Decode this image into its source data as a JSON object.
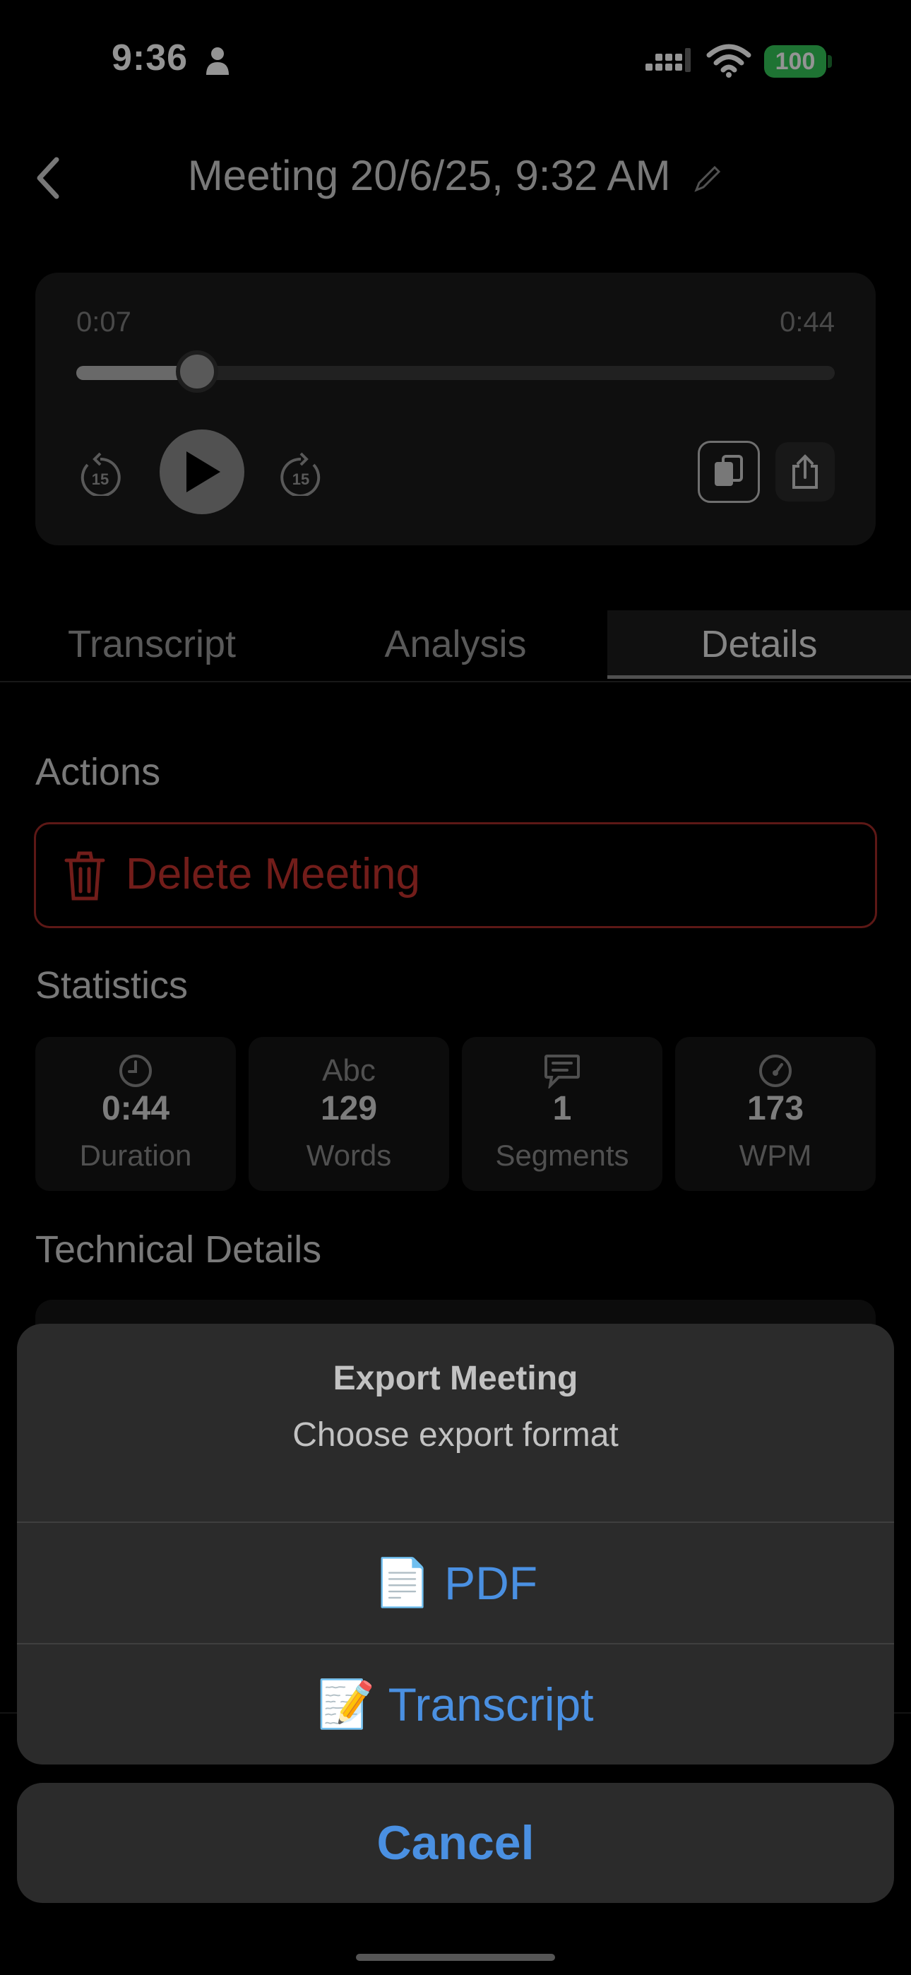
{
  "status": {
    "time": "9:36",
    "battery": "100"
  },
  "header": {
    "title": "Meeting 20/6/25, 9:32 AM"
  },
  "player": {
    "current_time": "0:07",
    "total_time": "0:44",
    "progress": 0.159,
    "skip_seconds": "15"
  },
  "tabs": [
    {
      "label": "Transcript"
    },
    {
      "label": "Analysis"
    },
    {
      "label": "Details"
    }
  ],
  "actions": {
    "title": "Actions",
    "delete_label": "Delete Meeting"
  },
  "statistics": {
    "title": "Statistics",
    "items": [
      {
        "icon": "clock-icon",
        "value": "0:44",
        "label": "Duration"
      },
      {
        "icon": "Abc",
        "value": "129",
        "label": "Words"
      },
      {
        "icon": "speech-bubble-icon",
        "value": "1",
        "label": "Segments"
      },
      {
        "icon": "speedometer-icon",
        "value": "173",
        "label": "WPM"
      }
    ]
  },
  "technical": {
    "title": "Technical Details"
  },
  "export_sheet": {
    "title": "Export Meeting",
    "message": "Choose export format",
    "options": [
      {
        "icon": "📄",
        "label": "PDF"
      },
      {
        "icon": "📝",
        "label": "Transcript"
      }
    ],
    "cancel_label": "Cancel"
  },
  "colors": {
    "accent": "#4a90e2",
    "destructive": "#c5322d",
    "battery": "#34c759"
  }
}
